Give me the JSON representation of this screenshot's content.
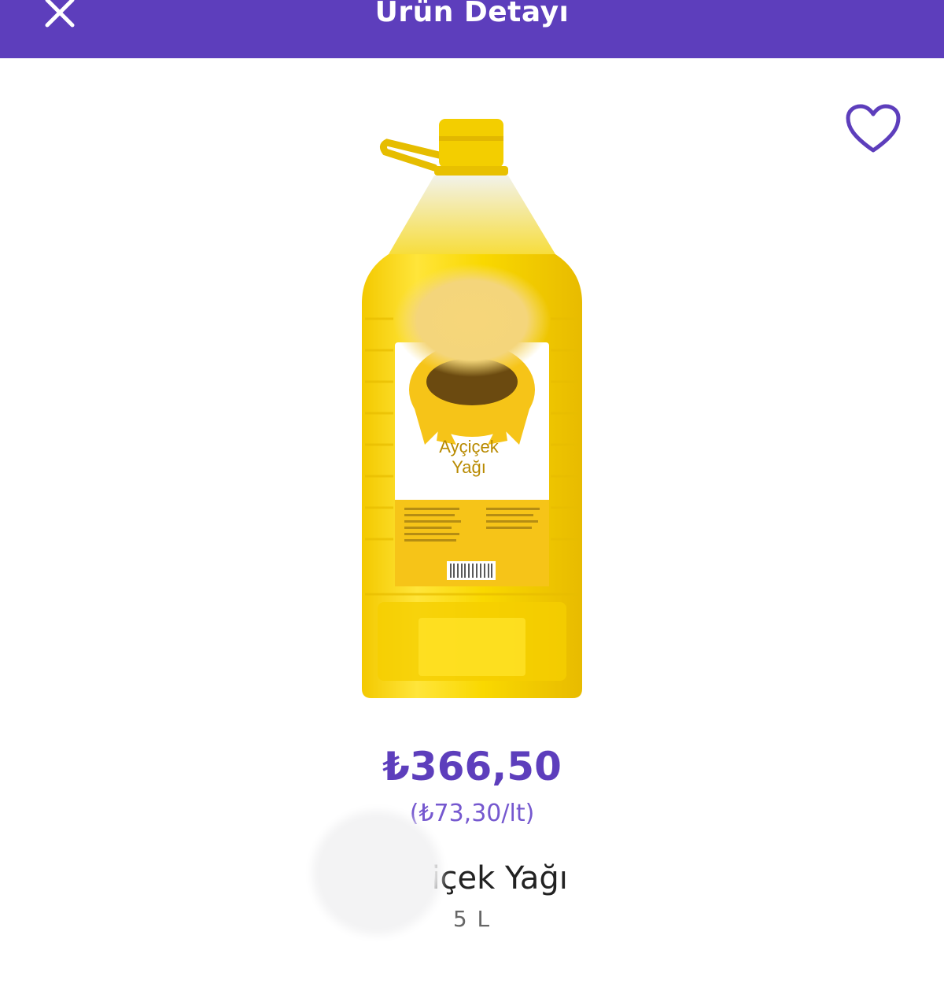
{
  "header": {
    "title": "Ürün Detayı",
    "background": "#5d3ebc",
    "close_icon": "close-icon"
  },
  "favorite": {
    "icon": "heart-outline-icon",
    "color": "#5d3ebc"
  },
  "product": {
    "image_label": [
      "Ayçiçek",
      "Yağı"
    ],
    "price": "₺366,50",
    "unit_price": "(₺73,30/lt)",
    "name": "Ayçiçek Yağı",
    "size": "5 L"
  },
  "colors": {
    "accent": "#5d3ebc",
    "oil_yellow": "#f7d400"
  }
}
